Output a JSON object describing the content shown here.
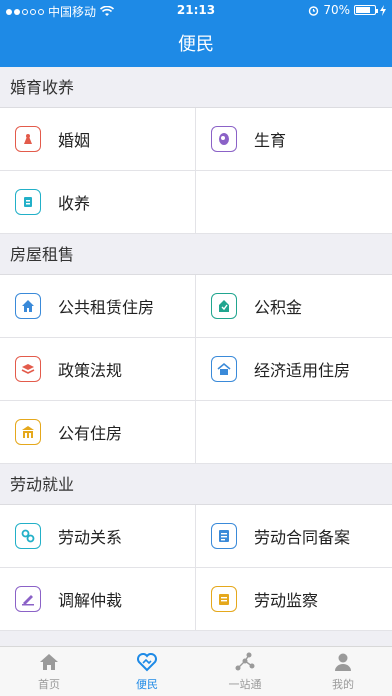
{
  "status": {
    "carrier": "中国移动",
    "time": "21:13",
    "battery": "70%"
  },
  "header": {
    "title": "便民"
  },
  "sections": [
    {
      "title": "婚育收养",
      "items": [
        {
          "label": "婚姻",
          "color": "#e35b4b",
          "icon": "marriage-icon"
        },
        {
          "label": "生育",
          "color": "#8b62c7",
          "icon": "birth-icon"
        },
        {
          "label": "收养",
          "color": "#22b0c8",
          "icon": "adoption-icon"
        }
      ]
    },
    {
      "title": "房屋租售",
      "items": [
        {
          "label": "公共租赁住房",
          "color": "#3a8ad9",
          "icon": "rental-house-icon"
        },
        {
          "label": "公积金",
          "color": "#21a58f",
          "icon": "fund-icon"
        },
        {
          "label": "政策法规",
          "color": "#e35b4b",
          "icon": "policy-icon"
        },
        {
          "label": "经济适用住房",
          "color": "#3a8ad9",
          "icon": "affordable-house-icon"
        },
        {
          "label": "公有住房",
          "color": "#e5a81c",
          "icon": "public-house-icon"
        }
      ]
    },
    {
      "title": "劳动就业",
      "items": [
        {
          "label": "劳动关系",
          "color": "#22b0c8",
          "icon": "labor-relation-icon"
        },
        {
          "label": "劳动合同备案",
          "color": "#3a8ad9",
          "icon": "contract-icon"
        },
        {
          "label": "调解仲裁",
          "color": "#8b62c7",
          "icon": "arbitration-icon"
        },
        {
          "label": "劳动监察",
          "color": "#e5a81c",
          "icon": "inspection-icon"
        }
      ]
    }
  ],
  "tabbar": [
    {
      "label": "首页",
      "icon": "home-icon"
    },
    {
      "label": "便民",
      "icon": "handshake-icon",
      "active": true
    },
    {
      "label": "一站通",
      "icon": "route-icon"
    },
    {
      "label": "我的",
      "icon": "user-icon"
    }
  ]
}
